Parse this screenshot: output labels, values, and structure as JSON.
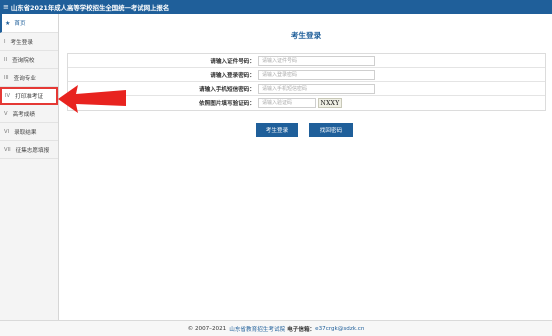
{
  "header": {
    "menu_icon": "≡",
    "title": "山东省2021年成人高等学校招生全国统一考试网上报名"
  },
  "sidebar": {
    "home_label": "首页",
    "items": [
      {
        "num": "I",
        "label": "考生登录"
      },
      {
        "num": "II",
        "label": "查询院校"
      },
      {
        "num": "III",
        "label": "查询专业"
      },
      {
        "num": "IV",
        "label": "打印准考证"
      },
      {
        "num": "V",
        "label": "高考成绩"
      },
      {
        "num": "VI",
        "label": "录取结果"
      },
      {
        "num": "VII",
        "label": "征集志愿填报"
      }
    ]
  },
  "main": {
    "title": "考生登录",
    "fields": {
      "id": {
        "label": "请输入证件号码：",
        "placeholder": "请输入证件号码"
      },
      "password": {
        "label": "请输入登录密码：",
        "placeholder": "请输入登录密码"
      },
      "sms": {
        "label": "请输入手机短信密码：",
        "placeholder": "请输入手机短信密码"
      },
      "captcha": {
        "label": "依照图片填写验证码：",
        "placeholder": "请输入验证码",
        "image_text": "NXXY"
      }
    },
    "login_button": "考生登录",
    "recover_button": "找回密码"
  },
  "footer": {
    "copyright": "© 2007–2021",
    "org": "山东省教育招生考试院",
    "email_label": "电子信箱：",
    "email": "e37crgk@sdzk.cn"
  },
  "colors": {
    "brand": "#1f5f9a",
    "highlight": "#e53935"
  }
}
